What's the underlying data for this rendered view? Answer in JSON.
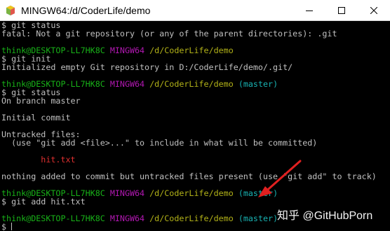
{
  "window": {
    "title": "MINGW64:/d/CoderLife/demo",
    "icon": "mingw-terminal-icon",
    "controls": [
      "minimize-icon",
      "maximize-icon",
      "close-icon"
    ]
  },
  "colors": {
    "background": "#000000",
    "text": "#c0c0c0",
    "user": "#18b218",
    "system": "#b218b2",
    "path": "#b2b218",
    "branch": "#18b2b2",
    "untracked_file": "#e03030",
    "annotation_arrow": "#e02020"
  },
  "terminal": {
    "lines": [
      [
        {
          "text": "$ git status",
          "style": "default"
        }
      ],
      [
        {
          "text": "fatal: Not a git repository (or any of the parent directories): .git",
          "style": "default"
        }
      ],
      [],
      [
        {
          "text": "think@DESKTOP-LL7HK8C",
          "style": "user"
        },
        {
          "text": " ",
          "style": "default"
        },
        {
          "text": "MINGW64",
          "style": "system"
        },
        {
          "text": " ",
          "style": "default"
        },
        {
          "text": "/d/CoderLife/demo",
          "style": "path"
        }
      ],
      [
        {
          "text": "$ git init",
          "style": "default"
        }
      ],
      [
        {
          "text": "Initialized empty Git repository in D:/CoderLife/demo/.git/",
          "style": "default"
        }
      ],
      [],
      [
        {
          "text": "think@DESKTOP-LL7HK8C",
          "style": "user"
        },
        {
          "text": " ",
          "style": "default"
        },
        {
          "text": "MINGW64",
          "style": "system"
        },
        {
          "text": " ",
          "style": "default"
        },
        {
          "text": "/d/CoderLife/demo",
          "style": "path"
        },
        {
          "text": " ",
          "style": "default"
        },
        {
          "text": "(master)",
          "style": "branch"
        }
      ],
      [
        {
          "text": "$ git status",
          "style": "default"
        }
      ],
      [
        {
          "text": "On branch master",
          "style": "default"
        }
      ],
      [],
      [
        {
          "text": "Initial commit",
          "style": "default"
        }
      ],
      [],
      [
        {
          "text": "Untracked files:",
          "style": "default"
        }
      ],
      [
        {
          "text": "  (use \"git add <file>...\" to include in what will be committed)",
          "style": "default"
        }
      ],
      [],
      [
        {
          "text": "        hit.txt",
          "style": "red"
        }
      ],
      [],
      [
        {
          "text": "nothing added to commit but untracked files present (use \"git add\" to track)",
          "style": "default"
        }
      ],
      [],
      [
        {
          "text": "think@DESKTOP-LL7HK8C",
          "style": "user"
        },
        {
          "text": " ",
          "style": "default"
        },
        {
          "text": "MINGW64",
          "style": "system"
        },
        {
          "text": " ",
          "style": "default"
        },
        {
          "text": "/d/CoderLife/demo",
          "style": "path"
        },
        {
          "text": " ",
          "style": "default"
        },
        {
          "text": "(master)",
          "style": "branch"
        }
      ],
      [
        {
          "text": "$ git add hit.txt",
          "style": "default"
        }
      ],
      [],
      [
        {
          "text": "think@DESKTOP-LL7HK8C",
          "style": "user"
        },
        {
          "text": " ",
          "style": "default"
        },
        {
          "text": "MINGW64",
          "style": "system"
        },
        {
          "text": " ",
          "style": "default"
        },
        {
          "text": "/d/CoderLife/demo",
          "style": "path"
        },
        {
          "text": " ",
          "style": "default"
        },
        {
          "text": "(master)",
          "style": "branch"
        }
      ],
      [
        {
          "text": "$ ",
          "style": "default"
        },
        {
          "cursor": true
        }
      ]
    ]
  },
  "watermark": {
    "text": "知乎 @GitHubPorn"
  }
}
